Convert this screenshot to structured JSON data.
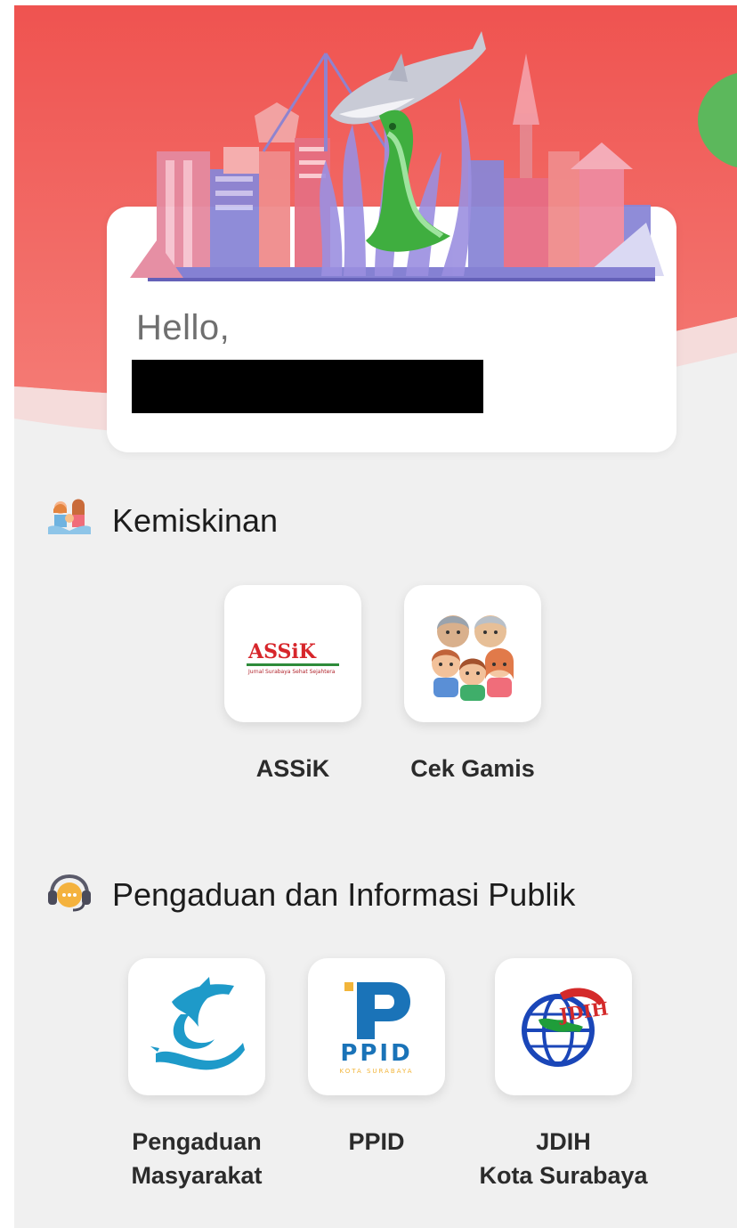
{
  "greeting": {
    "hello": "Hello,"
  },
  "sections": [
    {
      "title": "Kemiskinan",
      "icon": "family-support-icon",
      "apps": [
        {
          "label": "ASSiK",
          "icon": "assik-logo",
          "logo_text": "ASSiK",
          "logo_subtext": "Jurnal Surabaya Sehat Sejahtera"
        },
        {
          "label": "Cek Gamis",
          "icon": "family-icon"
        }
      ]
    },
    {
      "title": "Pengaduan dan Informasi Publik",
      "icon": "chat-support-icon",
      "apps": [
        {
          "label": "Pengaduan\nMasyarakat",
          "icon": "shark-crocodile-logo"
        },
        {
          "label": "PPID",
          "icon": "ppid-logo",
          "logo_text": "PPID",
          "logo_subtext": "KOTA SURABAYA"
        },
        {
          "label": "JDIH\nKota Surabaya",
          "icon": "jdih-globe-logo",
          "logo_text": "JDIH"
        }
      ]
    }
  ],
  "colors": {
    "hero_red": "#ee5a5a",
    "accent_green": "#5cb85c",
    "brand_blue": "#1a73b8"
  }
}
